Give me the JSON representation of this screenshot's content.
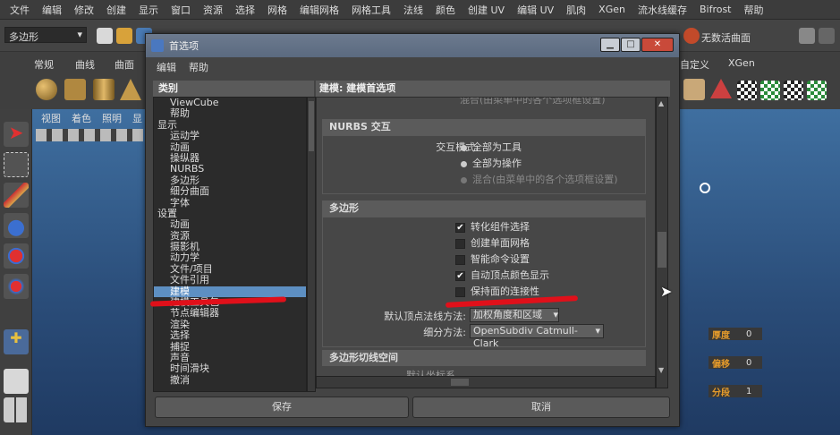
{
  "menubar": [
    "文件",
    "编辑",
    "修改",
    "创建",
    "显示",
    "窗口",
    "资源",
    "选择",
    "网格",
    "编辑网格",
    "网格工具",
    "法线",
    "颜色",
    "创建 UV",
    "编辑 UV",
    "肌肉",
    "XGen",
    "流水线缓存",
    "Bifrost",
    "帮助"
  ],
  "toolbar": {
    "mode": "多边形",
    "live_surface": "无数活曲面"
  },
  "shelf": {
    "tabs": [
      "常规",
      "曲线",
      "曲面"
    ],
    "right_tabs": [
      "自定义",
      "XGen"
    ]
  },
  "viewport": {
    "menu": [
      "视图",
      "着色",
      "照明",
      "显"
    ]
  },
  "channels": [
    {
      "label": "厚度",
      "value": "0"
    },
    {
      "label": "偏移",
      "value": "0"
    },
    {
      "label": "分段",
      "value": "1"
    }
  ],
  "dialog": {
    "title": "首选项",
    "menu": [
      "编辑",
      "帮助"
    ],
    "category_header": "类别",
    "categories": [
      {
        "text": "ViewCube",
        "level": 1
      },
      {
        "text": "帮助",
        "level": 1
      },
      {
        "text": "显示",
        "level": 0
      },
      {
        "text": "运动学",
        "level": 1
      },
      {
        "text": "动画",
        "level": 1
      },
      {
        "text": "操纵器",
        "level": 1
      },
      {
        "text": "NURBS",
        "level": 1
      },
      {
        "text": "多边形",
        "level": 1
      },
      {
        "text": "细分曲面",
        "level": 1
      },
      {
        "text": "字体",
        "level": 1
      },
      {
        "text": "设置",
        "level": 0
      },
      {
        "text": "动画",
        "level": 1
      },
      {
        "text": "资源",
        "level": 1
      },
      {
        "text": "摄影机",
        "level": 1
      },
      {
        "text": "动力学",
        "level": 1
      },
      {
        "text": "文件/项目",
        "level": 1
      },
      {
        "text": "文件引用",
        "level": 1
      },
      {
        "text": "建模",
        "level": 1,
        "selected": true
      },
      {
        "text": "建模工具包",
        "level": 1
      },
      {
        "text": "节点编辑器",
        "level": 1
      },
      {
        "text": "渲染",
        "level": 1
      },
      {
        "text": "选择",
        "level": 1
      },
      {
        "text": "捕捉",
        "level": 1
      },
      {
        "text": "声音",
        "level": 1
      },
      {
        "text": "时间滑块",
        "level": 1
      },
      {
        "text": "撤消",
        "level": 1
      }
    ],
    "right_header": "建模: 建模首选项",
    "top_cut_text": "混合(由菜单中的各个选项框设置)",
    "nurbs": {
      "title": "NURBS 交互",
      "label": "交互模式:",
      "options": [
        {
          "text": "全部为工具",
          "state": "on"
        },
        {
          "text": "全部为操作",
          "state": "on"
        },
        {
          "text": "混合(由菜单中的各个选项框设置)",
          "state": "dim"
        }
      ]
    },
    "poly": {
      "title": "多边形",
      "checks": [
        {
          "text": "转化组件选择",
          "checked": true
        },
        {
          "text": "创建单面网格",
          "checked": false
        },
        {
          "text": "智能命令设置",
          "checked": false
        },
        {
          "text": "自动顶点颜色显示",
          "checked": true
        },
        {
          "text": "保持面的连接性",
          "checked": false
        }
      ],
      "normal_label": "默认顶点法线方法:",
      "normal_value": "加权角度和区域",
      "subdiv_label": "细分方法:",
      "subdiv_value": "OpenSubdiv Catmull-Clark"
    },
    "poly_cut": {
      "title": "多边形切线空间",
      "cut_text": "默认坐标系"
    },
    "save": "保存",
    "cancel": "取消"
  },
  "colors": {
    "annotation": "#e0101a",
    "channel_label": "#e39a2b",
    "selection": "#5d8fc2"
  }
}
